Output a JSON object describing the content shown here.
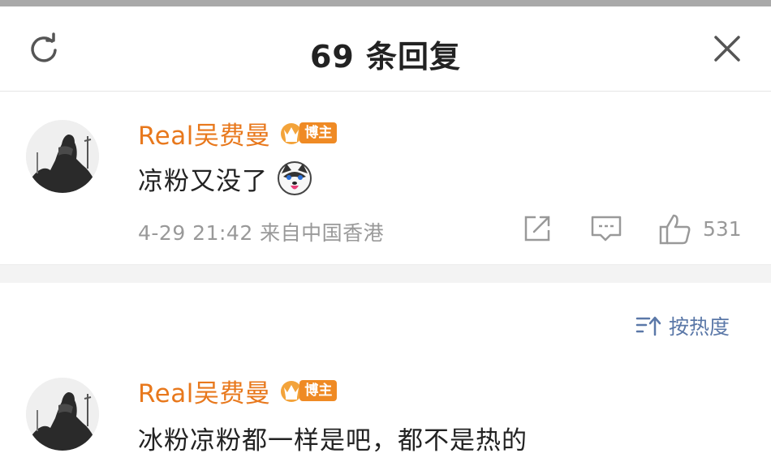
{
  "header": {
    "title": "69 条回复"
  },
  "main_comment": {
    "user": "Real吴费曼",
    "badge": "博主",
    "text": "凉粉又没了",
    "meta": "4-29 21:42 来自中国香港",
    "likes": "531"
  },
  "sort": {
    "label": "按热度"
  },
  "reply": {
    "user": "Real吴费曼",
    "badge": "博主",
    "text": "冰粉凉粉都一样是吧，都不是热的"
  },
  "colors": {
    "name": "#e8781c",
    "badge": "#ef8a24",
    "link": "#5b78a8",
    "meta": "#999999"
  },
  "icons": [
    "refresh-icon",
    "close-icon",
    "share-icon",
    "comment-icon",
    "like-icon",
    "sort-icon",
    "crown-icon",
    "husky-emoji"
  ]
}
